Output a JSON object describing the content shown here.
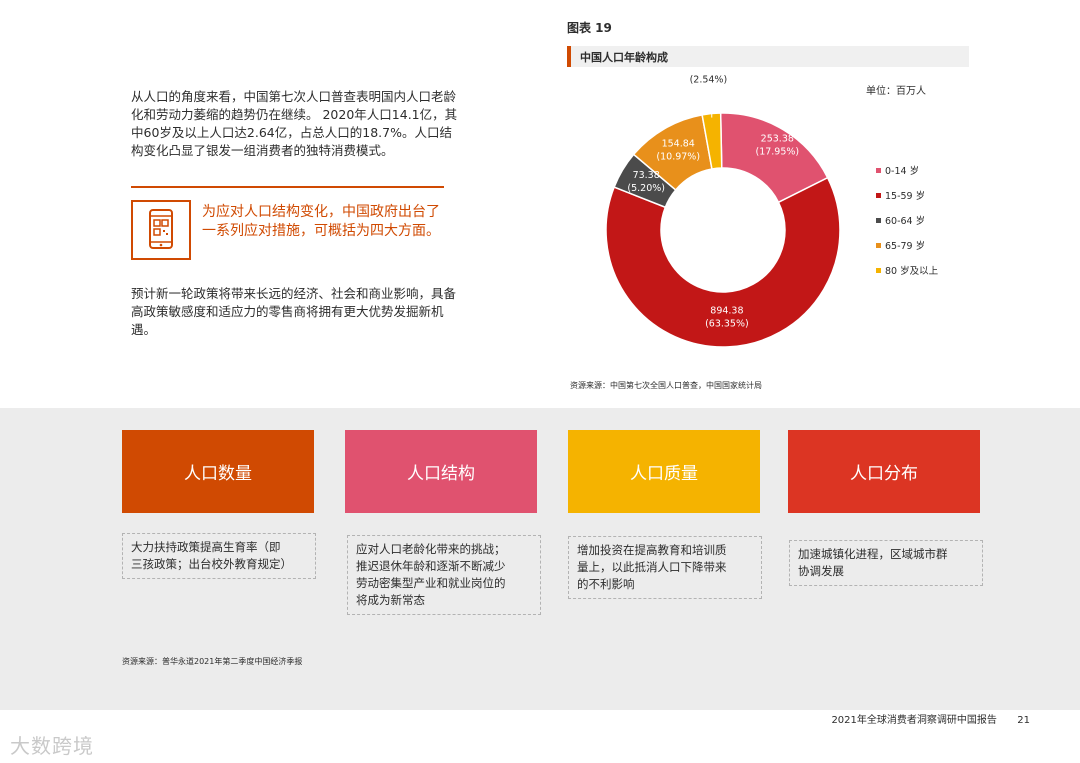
{
  "left": {
    "intro": "从人口的角度来看，中国第七次人口普查表明国内人口老龄化和劳动力萎缩的趋势仍在继续。 2020年人口14.1亿，其中60岁及以上人口达2.64亿，占总人口的18.7%。人口结构变化凸显了银发一组消费者的独特消费模式。",
    "callout": "为应对人口结构变化，中国政府出台了一系列应对措施，可概括为四大方面。",
    "outro": "预计新一轮政策将带来长远的经济、社会和商业影响，具备高政策敏感度和适应力的零售商将拥有更大优势发掘新机遇。"
  },
  "figure": {
    "number": "图表 19",
    "title": "中国人口年龄构成",
    "unit": "单位：百万人",
    "source": "资源来源：中国第七次全国人口普查，中国国家统计局"
  },
  "chart_data": {
    "type": "pie",
    "donut": true,
    "title": "中国人口年龄构成",
    "unit": "百万人",
    "legend_position": "right",
    "slices": [
      {
        "name": "0-14 岁",
        "value": 253.38,
        "percent": "17.95%",
        "color": "#e0526f",
        "label": "253.38",
        "pct_label": "(17.95%)"
      },
      {
        "name": "15-59 岁",
        "value": 894.38,
        "percent": "63.35%",
        "color": "#c21717",
        "label": "894.38",
        "pct_label": "(63.35%)"
      },
      {
        "name": "60-64 岁",
        "value": 73.38,
        "percent": "5.20%",
        "color": "#4b4b4b",
        "label": "73.38",
        "pct_label": "(5.20%)"
      },
      {
        "name": "65-79 岁",
        "value": 154.84,
        "percent": "10.97%",
        "color": "#e8901b",
        "label": "154.84",
        "pct_label": "(10.97%)"
      },
      {
        "name": "80 岁及以上",
        "value": 35.8,
        "percent": "2.54%",
        "color": "#f5b300",
        "label": "35.80",
        "pct_label": "(2.54%)"
      }
    ]
  },
  "cards": [
    {
      "title": "人口数量",
      "color": "#d04a02",
      "note": [
        "大力扶持政策提高生育率（即",
        "三孩政策；出台校外教育规定）"
      ]
    },
    {
      "title": "人口结构",
      "color": "#e0526f",
      "note": [
        "应对人口老龄化带来的挑战；",
        "推迟退休年龄和逐渐不断减少",
        "劳动密集型产业和就业岗位的",
        "将成为新常态"
      ]
    },
    {
      "title": "人口质量",
      "color": "#f5b300",
      "note": [
        "增加投资在提高教育和培训质",
        "量上，以此抵消人口下降带来",
        "的不利影响"
      ]
    },
    {
      "title": "人口分布",
      "color": "#dc3523",
      "note": [
        "加速城镇化进程，区域城市群",
        "协调发展"
      ]
    }
  ],
  "band_source": "资源来源：普华永道2021年第二季度中国经济季报",
  "footer": {
    "report": "2021年全球消费者洞察调研中国报告",
    "page": "21"
  },
  "watermark": "大数跨境"
}
